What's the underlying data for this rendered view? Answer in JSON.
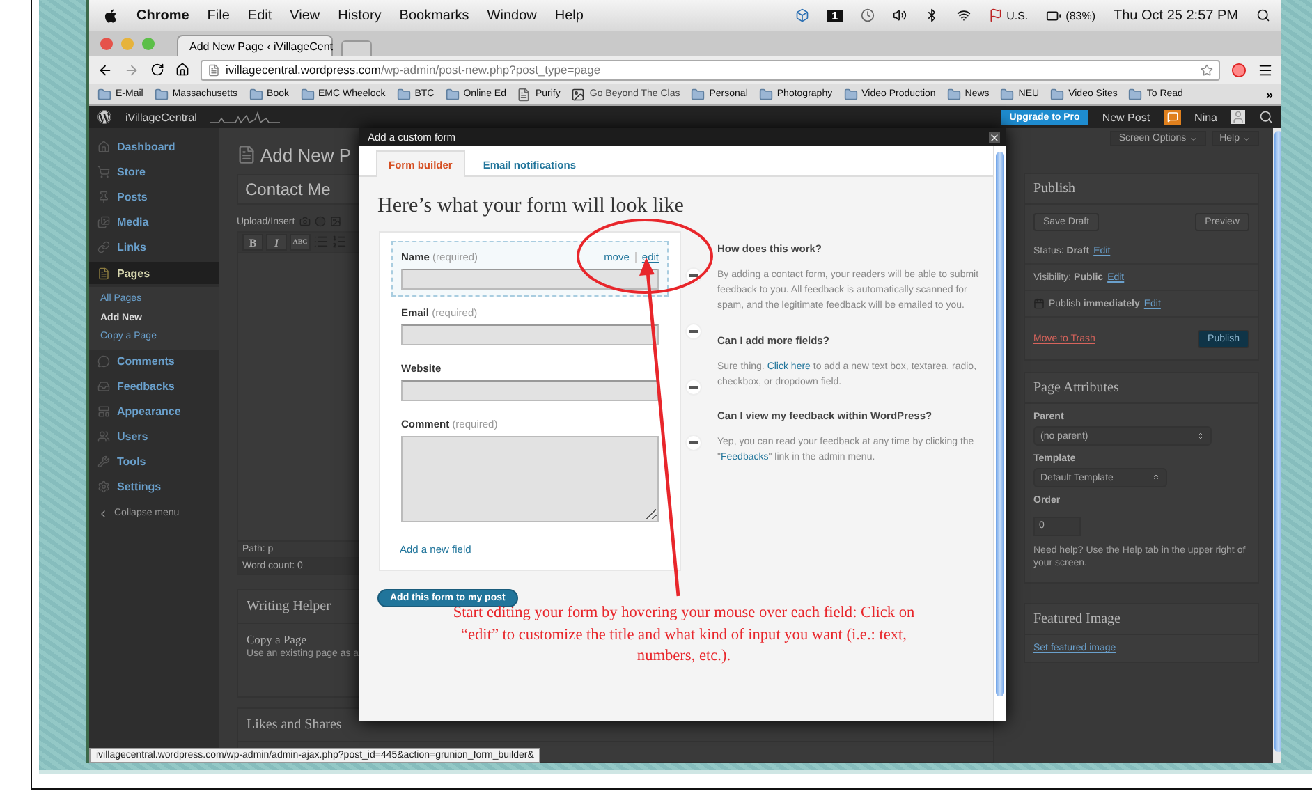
{
  "menubar": {
    "app": "Chrome",
    "menus": [
      "File",
      "Edit",
      "View",
      "History",
      "Bookmarks",
      "Window",
      "Help"
    ],
    "badge": "1",
    "input_source": "U.S.",
    "battery": "(83%)",
    "clock": "Thu Oct 25 2:57 PM"
  },
  "browser": {
    "tabs": [
      {
        "label": "Add New Page ‹ iVillageCent",
        "selected": true
      }
    ],
    "url_host": "ivillagecentral.wordpress.com",
    "url_path": "/wp-admin/post-new.php?post_type=page",
    "bookmarks": [
      {
        "label": "E-Mail",
        "kind": "folder"
      },
      {
        "label": "Massachusetts",
        "kind": "folder"
      },
      {
        "label": "Book",
        "kind": "folder"
      },
      {
        "label": "EMC Wheelock",
        "kind": "folder"
      },
      {
        "label": "BTC",
        "kind": "folder"
      },
      {
        "label": "Online Ed",
        "kind": "folder"
      },
      {
        "label": "Purify",
        "kind": "page"
      },
      {
        "label": "Go Beyond The Clas",
        "kind": "image"
      },
      {
        "label": "Personal",
        "kind": "folder"
      },
      {
        "label": "Photography",
        "kind": "folder"
      },
      {
        "label": "Video Production",
        "kind": "folder"
      },
      {
        "label": "News",
        "kind": "folder"
      },
      {
        "label": "NEU",
        "kind": "folder"
      },
      {
        "label": "Video Sites",
        "kind": "folder"
      },
      {
        "label": "To Read",
        "kind": "folder"
      }
    ],
    "more": "»"
  },
  "admin_bar": {
    "site": "iVillageCentral",
    "upgrade": "Upgrade to Pro",
    "new_post": "New Post",
    "user": "Nina"
  },
  "sidebar": {
    "items": [
      {
        "label": "Dashboard",
        "selected": false
      },
      {
        "label": "Store",
        "selected": false
      },
      {
        "label": "Posts",
        "selected": false
      },
      {
        "label": "Media",
        "selected": false
      },
      {
        "label": "Links",
        "selected": false
      },
      {
        "label": "Pages",
        "selected": true,
        "children": [
          {
            "label": "All Pages",
            "selected": false
          },
          {
            "label": "Add New",
            "selected": true
          },
          {
            "label": "Copy a Page",
            "selected": false
          }
        ]
      },
      {
        "label": "Comments",
        "selected": false
      },
      {
        "label": "Feedbacks",
        "selected": false
      },
      {
        "label": "Appearance",
        "selected": false
      },
      {
        "label": "Users",
        "selected": false
      },
      {
        "label": "Tools",
        "selected": false
      },
      {
        "label": "Settings",
        "selected": false
      }
    ],
    "collapse": "Collapse menu"
  },
  "editor": {
    "heading": "Add New P",
    "title_value": "Contact Me",
    "upload_label": "Upload/Insert",
    "format_buttons": [
      "B",
      "I",
      "ABC"
    ],
    "path": "Path: p",
    "word_count": "Word count: 0",
    "boxes": [
      {
        "title": "Writing Helper",
        "item": "Copy a Page",
        "description": "Use an existing page as a"
      },
      {
        "title": "Likes and Shares"
      }
    ]
  },
  "side_column": {
    "screen_options": "Screen Options",
    "help": "Help",
    "publish": {
      "title": "Publish",
      "save_draft": "Save Draft",
      "preview": "Preview",
      "rows": [
        {
          "text": "Status: **Draft**",
          "link": "Edit"
        },
        {
          "text": "Visibility: **Public**",
          "link": "Edit"
        },
        {
          "text": "Publish **immediately**",
          "link": "Edit"
        }
      ],
      "trash": "Move to Trash",
      "button": "Publish"
    },
    "attributes": {
      "title": "Page Attributes",
      "parent_label": "Parent",
      "parent_value": "(no parent)",
      "template_label": "Template",
      "template_value": "Default Template",
      "order_label": "Order",
      "order_value": "0",
      "help": "Need help? Use the Help tab in the upper right of your screen."
    },
    "featured": {
      "title": "Featured Image",
      "link": "Set featured image"
    }
  },
  "modal": {
    "title": "Add a custom form",
    "tabs": [
      {
        "label": "Form builder",
        "selected": true
      },
      {
        "label": "Email notifications",
        "selected": false
      }
    ],
    "heading": "Here’s what your form will look like",
    "fields": [
      {
        "label": "Name",
        "note": "(required)",
        "kind": "text",
        "hovered": true
      },
      {
        "label": "Email",
        "note": "(required)",
        "kind": "text",
        "hovered": false
      },
      {
        "label": "Website",
        "kind": "text",
        "hovered": false
      },
      {
        "label": "Comment",
        "note": "(required)",
        "kind": "textarea",
        "hovered": false
      }
    ],
    "hover_actions": [
      "move",
      "edit"
    ],
    "add_field": "Add a new field",
    "submit": "Add this form to my post",
    "help": [
      {
        "question": "How does this work?",
        "answer": [
          {
            "text": "By adding a contact form, your readers will be able to submit feedback to you. All feedback is automatically scanned for spam, and the legitimate feedback will be emailed to you.",
            "link": false
          }
        ]
      },
      {
        "question": "Can I add more fields?",
        "answer": [
          {
            "text": "Sure thing. ",
            "link": false
          },
          {
            "text": "Click here",
            "link": true
          },
          {
            "text": " to add a new text box, textarea, radio, checkbox, or dropdown field.",
            "link": false
          }
        ]
      },
      {
        "question": "Can I view my feedback within WordPress?",
        "answer": [
          {
            "text": "Yep, you can read your feedback at any time by clicking the \"",
            "link": false
          },
          {
            "text": "Feedbacks",
            "link": true
          },
          {
            "text": "\" link in the admin menu.",
            "link": false
          }
        ]
      }
    ]
  },
  "annotation": "Start editing your form by hovering your mouse over each field: Click on “edit” to customize the title and what kind of input you want (i.e.: text, numbers, etc.).",
  "status_url": "ivillagecentral.wordpress.com/wp-admin/admin-ajax.php?post_id=445&action=grunion_form_builder&"
}
